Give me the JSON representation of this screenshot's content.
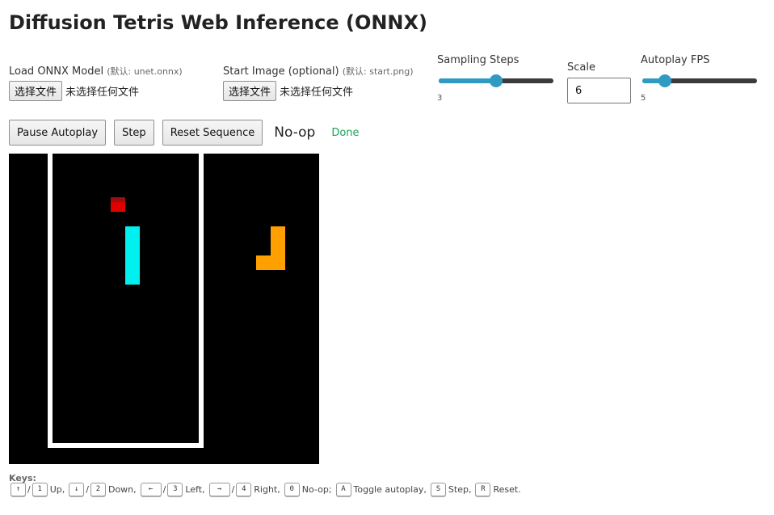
{
  "title": "Diffusion Tetris Web Inference (ONNX)",
  "model_loader": {
    "label": "Load ONNX Model",
    "hint": "(默认: unet.onnx)",
    "button": "选择文件",
    "status": "未选择任何文件"
  },
  "image_loader": {
    "label": "Start Image (optional)",
    "hint": "(默认: start.png)",
    "button": "选择文件",
    "status": "未选择任何文件"
  },
  "sampling_steps": {
    "label": "Sampling Steps",
    "value": "3",
    "level": 0.5
  },
  "scale": {
    "label": "Scale",
    "value": "6"
  },
  "autoplay_fps": {
    "label": "Autoplay FPS",
    "value": "5",
    "level": 0.2
  },
  "controls": {
    "pause_label": "Pause Autoplay",
    "step_label": "Step",
    "reset_label": "Reset Sequence",
    "action_text": "No-op",
    "status_text": "Done"
  },
  "colors": {
    "accent": "#2f9bc3",
    "status_ok": "#1aa35a",
    "piece_red": "#e00000",
    "piece_cyan": "#00f0f0",
    "piece_orange": "#ffa000"
  },
  "keys": {
    "title": "Keys:",
    "up_arrow": "↑",
    "up_num": "1",
    "up_desc": "Up,",
    "down_arrow": "↓",
    "down_num": "2",
    "down_desc": "Down,",
    "left_arrow": "←",
    "left_num": "3",
    "left_desc": "Left,",
    "right_arrow": "→",
    "right_num": "4",
    "right_desc": "Right,",
    "noop_key": "0",
    "noop_desc": "No-op;",
    "a_key": "A",
    "a_desc": "Toggle autoplay,",
    "s_key": "S",
    "s_desc": "Step,",
    "r_key": "R",
    "r_desc": "Reset.",
    "sep": "/"
  }
}
